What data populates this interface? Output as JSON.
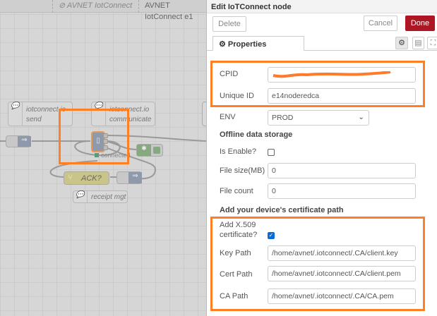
{
  "workspace_tabs": [
    {
      "label": "⊘ AVNET IotConnect",
      "disabled": true
    },
    {
      "label": "AVNET IotConnect e1"
    }
  ],
  "flow": {
    "comments": [
      "iotconnect.io send",
      "iotconnect.io communicate",
      "receipt mgt"
    ],
    "comment_lines": {
      "send": [
        "iotconnect.io",
        "send"
      ],
      "communicate": [
        "iotconnect.io",
        "communicate"
      ]
    },
    "switch_label": "ACK?",
    "status_text": "connected",
    "status_color": "#5a9a78"
  },
  "panel": {
    "title": "Edit IoTConnect node",
    "delete_label": "Delete",
    "cancel_label": "Cancel",
    "done_label": "Done",
    "tab_properties": "Properties",
    "fields": {
      "cpid_label": "CPID",
      "unique_id_label": "Unique ID",
      "unique_id_value": "e14noderedca",
      "env_label": "ENV",
      "env_value": "PROD",
      "offline_heading": "Offline data storage",
      "is_enable_label": "Is Enable?",
      "is_enable_checked": false,
      "file_size_label": "File size(MB)",
      "file_size_value": "0",
      "file_count_label": "File count",
      "file_count_value": "0",
      "cert_heading": "Add your device's certificate path",
      "x509_label_1": "Add X.509",
      "x509_label_2": "certificate?",
      "x509_checked": true,
      "key_path_label": "Key Path",
      "key_path_value": "/home/avnet/.iotconnect/.CA/client.key",
      "cert_path_label": "Cert Path",
      "cert_path_value": "/home/avnet/.iotconnect/.CA/client.pem",
      "ca_path_label": "CA Path",
      "ca_path_value": "/home/avnet/.iotconnect/.CA/CA.pem"
    }
  },
  "colors": {
    "done": "#ad1625",
    "highlight": "#ff7f24",
    "redaction": "#ff7a2a"
  }
}
